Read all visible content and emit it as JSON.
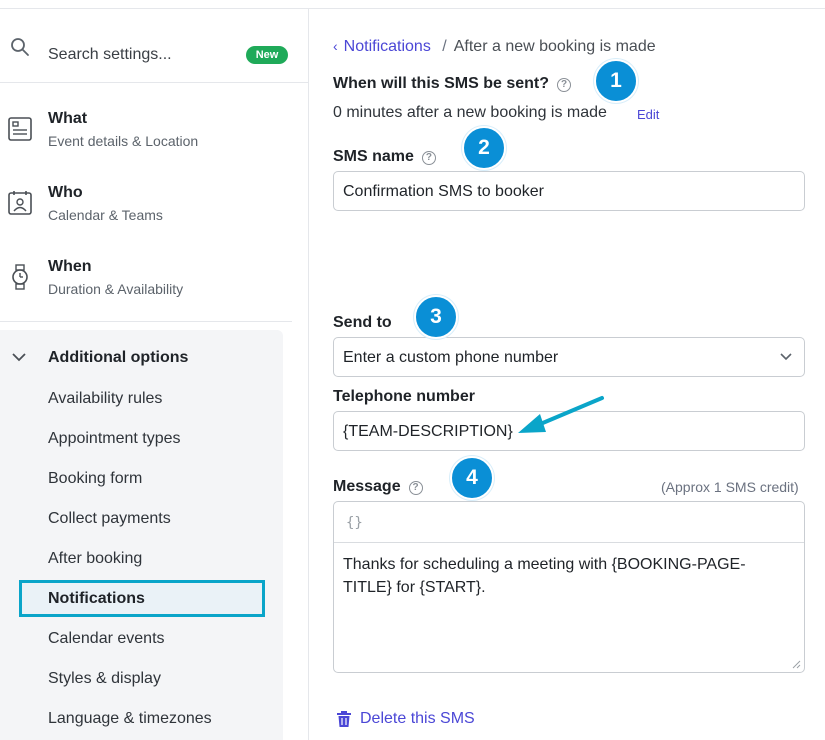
{
  "sidebar": {
    "search": {
      "placeholder": "Search settings...",
      "badge": "New"
    },
    "items": [
      {
        "title": "What",
        "subtitle": "Event details & Location",
        "icon": "form-icon"
      },
      {
        "title": "Who",
        "subtitle": "Calendar & Teams",
        "icon": "contact-calendar-icon"
      },
      {
        "title": "When",
        "subtitle": "Duration & Availability",
        "icon": "watch-icon"
      }
    ],
    "additional": {
      "header": "Additional options",
      "items": [
        "Availability rules",
        "Appointment types",
        "Booking form",
        "Collect payments",
        "After booking",
        "Notifications",
        "Calendar events",
        "Styles & display",
        "Language & timezones"
      ],
      "active": "Notifications"
    }
  },
  "breadcrumb": {
    "parent": "Notifications",
    "separator": "/",
    "current": "After a new booking is made"
  },
  "form": {
    "when_label": "When will this SMS be sent?",
    "when_value": "0 minutes after a new booking is made",
    "edit_label": "Edit",
    "name_label": "SMS name",
    "name_value": "Confirmation SMS to booker",
    "send_to_label": "Send to",
    "send_to_value": "Enter a custom phone number",
    "phone_label": "Telephone number",
    "phone_value": "{TEAM-DESCRIPTION}",
    "message_label": "Message",
    "message_credit": "(Approx 1 SMS credit)",
    "message_toolbar_icon": "{}",
    "message_value": "Thanks for scheduling a meeting with {BOOKING-PAGE-TITLE} for {START}.",
    "delete_label": "Delete this SMS"
  },
  "annotations": {
    "steps": [
      "1",
      "2",
      "3",
      "4"
    ]
  },
  "colors": {
    "accent": "#4b47d6",
    "badge": "#1faa59",
    "annotation": "#0a8fd6",
    "highlight": "#0aa5c9"
  }
}
